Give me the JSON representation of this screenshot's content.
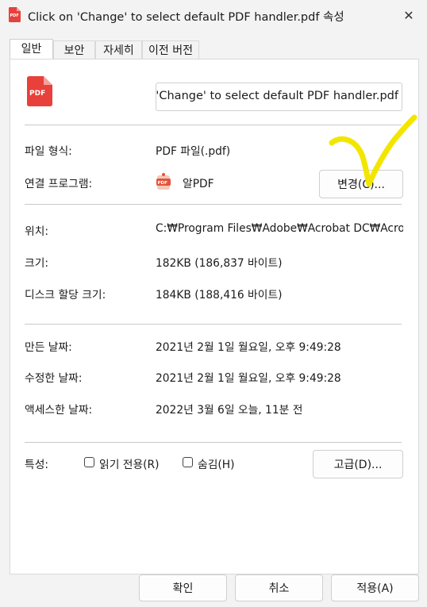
{
  "window": {
    "title": "Click on 'Change' to select default PDF handler.pdf 속성",
    "close_glyph": "✕"
  },
  "tabs": [
    {
      "label": "일반",
      "active": true
    },
    {
      "label": "보안",
      "active": false
    },
    {
      "label": "자세히",
      "active": false
    },
    {
      "label": "이전 버전",
      "active": false
    }
  ],
  "file": {
    "icon": "pdf-file-icon",
    "icon_text": "PDF",
    "name_visible": "n 'Change' to select default PDF handler.pdf"
  },
  "type": {
    "label": "파일 형식:",
    "value": "PDF 파일(.pdf)"
  },
  "opens_with": {
    "label": "연결 프로그램:",
    "icon": "alpdf-app-icon",
    "app_name": "알PDF",
    "change_button": "변경(C)..."
  },
  "location": {
    "label": "위치:",
    "value": "C:₩Program Files₩Adobe₩Acrobat DC₩Acrob"
  },
  "size": {
    "label": "크기:",
    "value": "182KB (186,837 바이트)"
  },
  "size_on_disk": {
    "label": "디스크 할당 크기:",
    "value": "184KB (188,416 바이트)"
  },
  "created": {
    "label": "만든 날짜:",
    "value": "2021년 2월 1일 월요일, 오후 9:49:28"
  },
  "modified": {
    "label": "수정한 날짜:",
    "value": "2021년 2월 1일 월요일, 오후 9:49:28"
  },
  "accessed": {
    "label": "액세스한 날짜:",
    "value": "2022년 3월 6일 오늘, 11분 전"
  },
  "attributes": {
    "label": "특성:",
    "readonly": {
      "label": "읽기 전용(R)",
      "checked": false
    },
    "hidden": {
      "label": "숨김(H)",
      "checked": false
    },
    "advanced_button": "고급(D)..."
  },
  "footer": {
    "ok": "확인",
    "cancel": "취소",
    "apply": "적용(A)"
  },
  "colors": {
    "pdf_red": "#e8403a",
    "annotation_yellow": "#f2e600",
    "panel_bg": "#ffffff",
    "window_bg": "#f3f3f3"
  }
}
